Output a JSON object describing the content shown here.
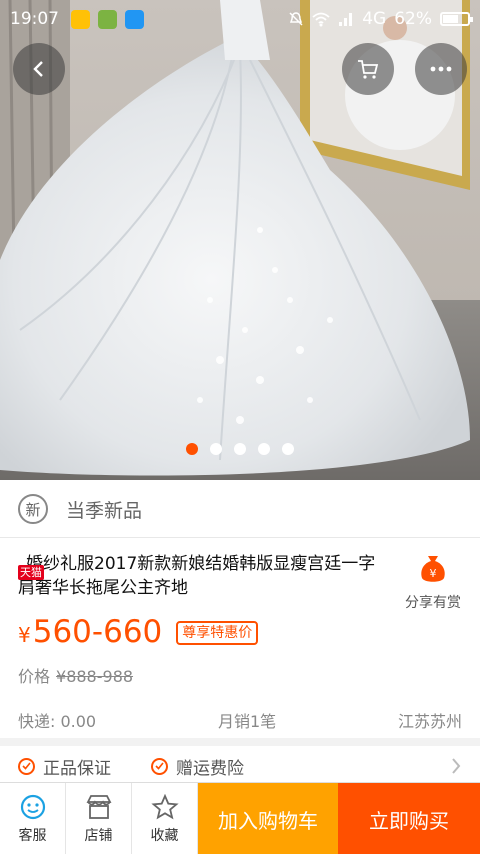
{
  "status_bar": {
    "time": "19:07",
    "network": "4G",
    "battery": "62%",
    "battery_level": 0.62
  },
  "hero": {
    "image_count": 5,
    "active_index": 0
  },
  "product": {
    "season_badge": "新",
    "season_label": "当季新品",
    "store_badge": "天猫",
    "title": "婚纱礼服2017新款新娘结婚韩版显瘦宫廷一字肩奢华长拖尾公主齐地",
    "share_label": "分享有赏",
    "currency": "¥",
    "price": "560-660",
    "promo_label": "尊享特惠价",
    "old_price_label": "价格",
    "old_price": "¥888-988",
    "shipping": "快递: 0.00",
    "monthly_sales": "月销1笔",
    "location": "江苏苏州"
  },
  "guarantees": [
    "正品保证",
    "赠运费险"
  ],
  "bottom_bar": {
    "service_label": "客服",
    "shop_label": "店铺",
    "favorite_label": "收藏",
    "add_cart_label": "加入购物车",
    "buy_now_label": "立即购买"
  },
  "colors": {
    "accent": "#ff5000",
    "cart": "#ffa200",
    "tmall": "#e4001b"
  }
}
